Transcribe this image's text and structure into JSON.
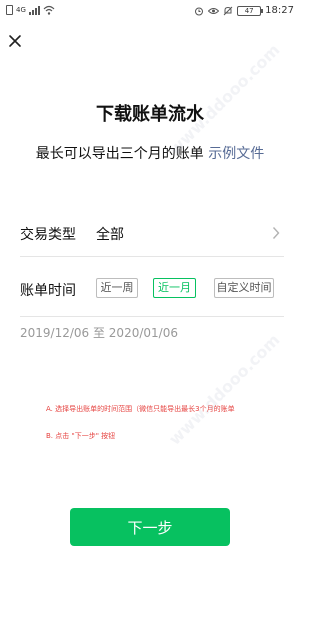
{
  "status_bar": {
    "network_label": "4G",
    "battery": "47",
    "time": "18:27",
    "icons": [
      "sim-icon",
      "signal-icon",
      "wifi-icon",
      "alarm-icon",
      "eye-icon",
      "mute-icon",
      "battery-icon"
    ]
  },
  "header": {
    "close_icon": "close-icon"
  },
  "page": {
    "title": "下载账单流水",
    "subtitle_prefix": "最长可以导出三个月的账单",
    "sample_link": "示例文件"
  },
  "form": {
    "type_label": "交易类型",
    "type_value": "全部",
    "time_label": "账单时间",
    "period_options": [
      "近一周",
      "近一月",
      "自定义时间"
    ],
    "selected_period": "近一月",
    "date_range": "2019/12/06 至 2020/01/06"
  },
  "notes": {
    "a": "A. 选择导出账单的时间范围（微信只能导出最长3个月的账单",
    "b": "B. 点击 \"下一步\" 按钮"
  },
  "next_button": "下一步",
  "watermark": "www.ddooo.com",
  "colors": {
    "accent_green": "#07c160",
    "link_blue": "#576b95",
    "note_red": "#e64340",
    "muted_text": "#999999"
  }
}
